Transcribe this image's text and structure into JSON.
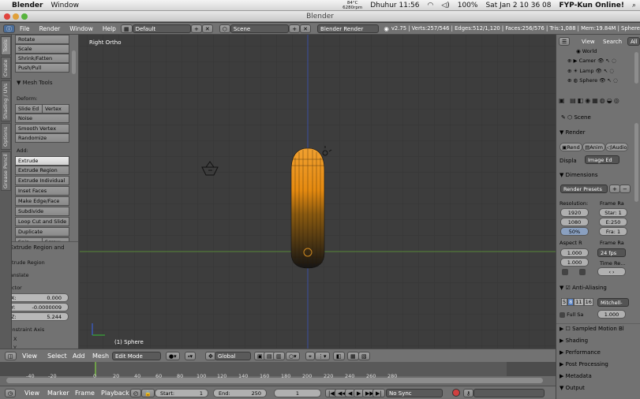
{
  "mac": {
    "apple": "",
    "app": "Blender",
    "window": "Window",
    "temp": "84°C",
    "rpm": "6280rpm",
    "user": "Dhuhur 11:56",
    "battery": "100%",
    "datetime": "Sat Jan 2  10 36 08",
    "status": "FYP-Kun Online!"
  },
  "window_title": "Blender",
  "header": {
    "file": "File",
    "render": "Render",
    "window": "Window",
    "help": "Help",
    "layout": "Default",
    "scene": "Scene",
    "engine": "Blender Render",
    "stats": "v2.75 | Verts:257/546 | Edges:512/1,120 | Faces:256/576 | Tris:1,088 | Mem:19.84M | Sphere"
  },
  "tabs": [
    "Tools",
    "Create",
    "Shading / UVs",
    "Options",
    "Grease Pencil"
  ],
  "tools": {
    "rotate": "Rotate",
    "scale": "Scale",
    "shrink": "Shrink/Fatten",
    "push": "Push/Pull",
    "mesh_tools": "▼ Mesh Tools",
    "deform": "Deform:",
    "slide_edge": "Slide Ed",
    "vertex": "Vertex",
    "noise": "Noise",
    "smooth": "Smooth Vertex",
    "randomize": "Randomize",
    "add": "Add:",
    "extrude": "Extrude",
    "extrude_region": "Extrude Region",
    "extrude_indiv": "Extrude Individual",
    "inset": "Inset Faces",
    "make_edge": "Make Edge/Face",
    "subdivide": "Subdivide",
    "loopcut": "Loop Cut and Slide",
    "duplicate": "Duplicate",
    "spin": "Spin",
    "screw": "Screw"
  },
  "operator": {
    "title": "▼ Extrude Region and",
    "name": "Extrude Region",
    "translate": "Translate",
    "vector": "Vector",
    "x_label": "X:",
    "x_val": "0.000",
    "y_label": "Y:",
    "y_val": "-0.0000009",
    "z_label": "Z:",
    "z_val": "5.244",
    "constraint": "Constraint Axis",
    "cx": "X",
    "cy": "Y"
  },
  "viewport": {
    "label": "Right Ortho",
    "object": "(1) Sphere"
  },
  "view_header": {
    "view": "View",
    "select": "Select",
    "add": "Add",
    "mesh": "Mesh",
    "mode": "Edit Mode",
    "orientation": "Global"
  },
  "outliner": {
    "view": "View",
    "search": "Search",
    "all": "All",
    "items": [
      "World",
      "Camer",
      "Lamp",
      "Sphere"
    ]
  },
  "props": {
    "scene": "Scene",
    "render": "Render",
    "rend": "Rend",
    "anim": "Anim",
    "audio": "Audio",
    "display_label": "Displa",
    "display_val": "Image Ed",
    "dimensions": "Dimensions",
    "presets": "Render Presets",
    "resolution": "Resolution:",
    "frame_range": "Frame Ra",
    "res_x": "1920",
    "res_y": "1080",
    "res_pct": "50%",
    "start": "Star: 1",
    "end": "E:250",
    "frame": "Fra: 1",
    "aspect": "Aspect R",
    "aspect_x": "1.000",
    "aspect_y": "1.000",
    "frame_rate": "Frame Ra",
    "fps": "24 fps",
    "time_re": "Time Re...",
    "aa": "Anti-Aliasing",
    "aa_samples": [
      "5",
      "8",
      "11",
      "16"
    ],
    "aa_filter": "Mitchell-",
    "full_sample": "Full Sa",
    "aa_size": "1.000",
    "sampled_motion": "Sampled Motion Bl",
    "shading": "Shading",
    "performance": "Performance",
    "post": "Post Processing",
    "metadata": "Metadata",
    "output": "Output"
  },
  "timeline": {
    "ticks": [
      "-40",
      "-20",
      "0",
      "20",
      "40",
      "60",
      "80",
      "100",
      "120",
      "140",
      "160",
      "180",
      "200",
      "220",
      "240",
      "260",
      "280"
    ],
    "view": "View",
    "marker": "Marker",
    "frame": "Frame",
    "playback": "Playback",
    "start": "Start:",
    "start_val": "1",
    "end": "End:",
    "end_val": "250",
    "current": "1",
    "sync": "No Sync"
  }
}
